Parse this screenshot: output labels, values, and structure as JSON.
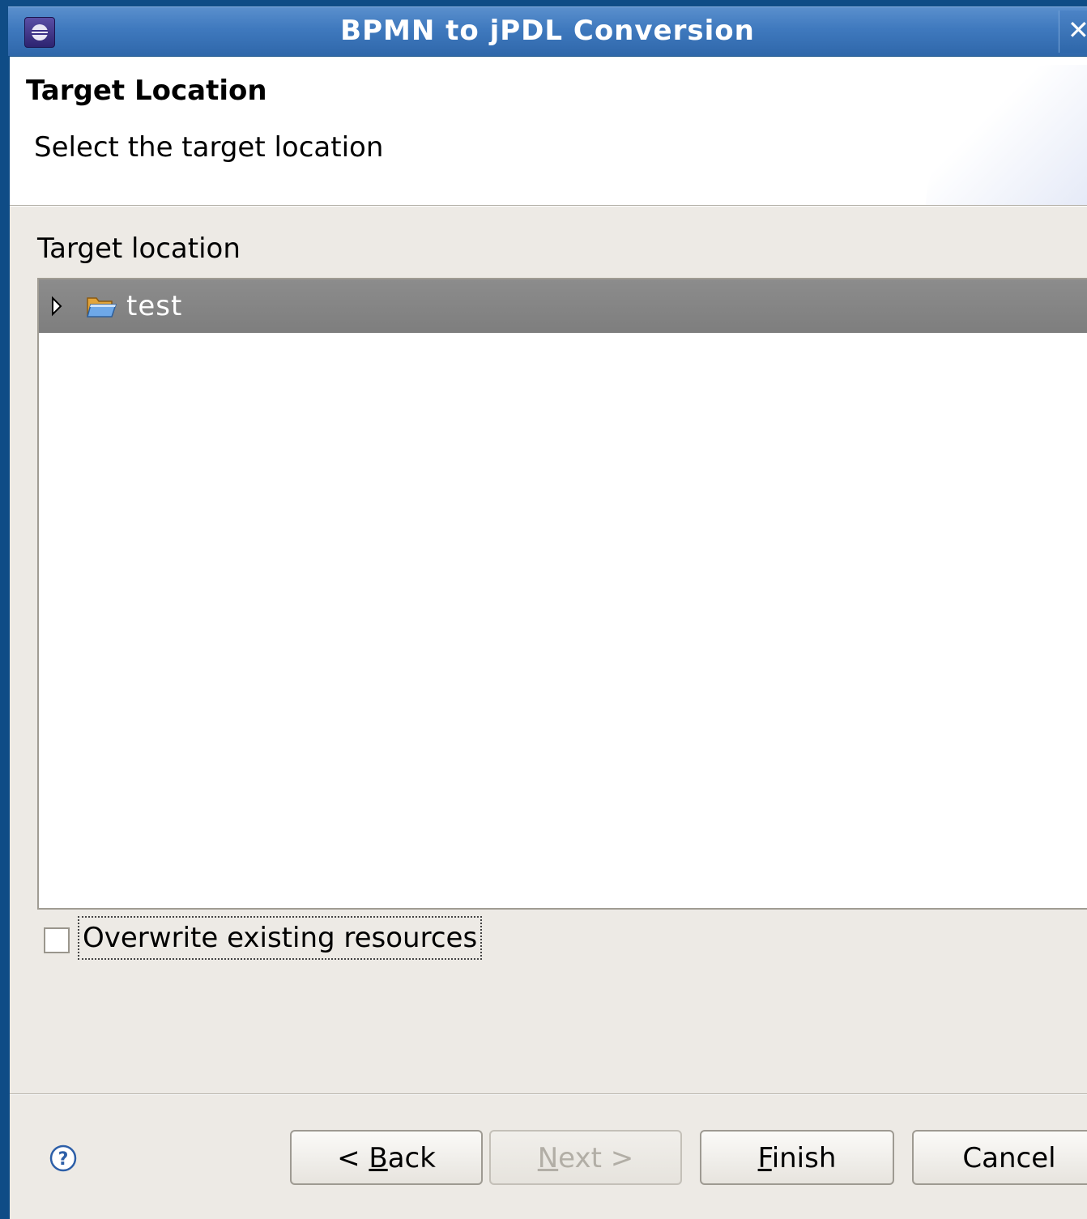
{
  "window": {
    "title": "BPMN to jPDL Conversion",
    "close_icon": "close-icon",
    "app_icon": "eclipse-icon"
  },
  "header": {
    "title": "Target Location",
    "description": "Select the target location"
  },
  "content": {
    "section_label": "Target location",
    "tree": {
      "items": [
        {
          "label": "test",
          "icon": "folder-open-icon",
          "expander_icon": "triangle-right-icon",
          "selected": true
        }
      ]
    },
    "overwrite_checkbox": {
      "label": "Overwrite existing resources",
      "checked": false
    }
  },
  "footer": {
    "help_icon": "help-icon",
    "buttons": {
      "back": {
        "prefix": "< ",
        "mnemonic": "B",
        "rest": "ack",
        "enabled": true
      },
      "next": {
        "mnemonic": "N",
        "rest": "ext >",
        "enabled": false
      },
      "finish": {
        "mnemonic": "F",
        "rest": "inish",
        "enabled": true
      },
      "cancel": {
        "label": "Cancel",
        "enabled": true
      }
    }
  },
  "colors": {
    "titlebar": "#3f79be",
    "selection": "#858585",
    "dialog_background": "#edeae5"
  }
}
